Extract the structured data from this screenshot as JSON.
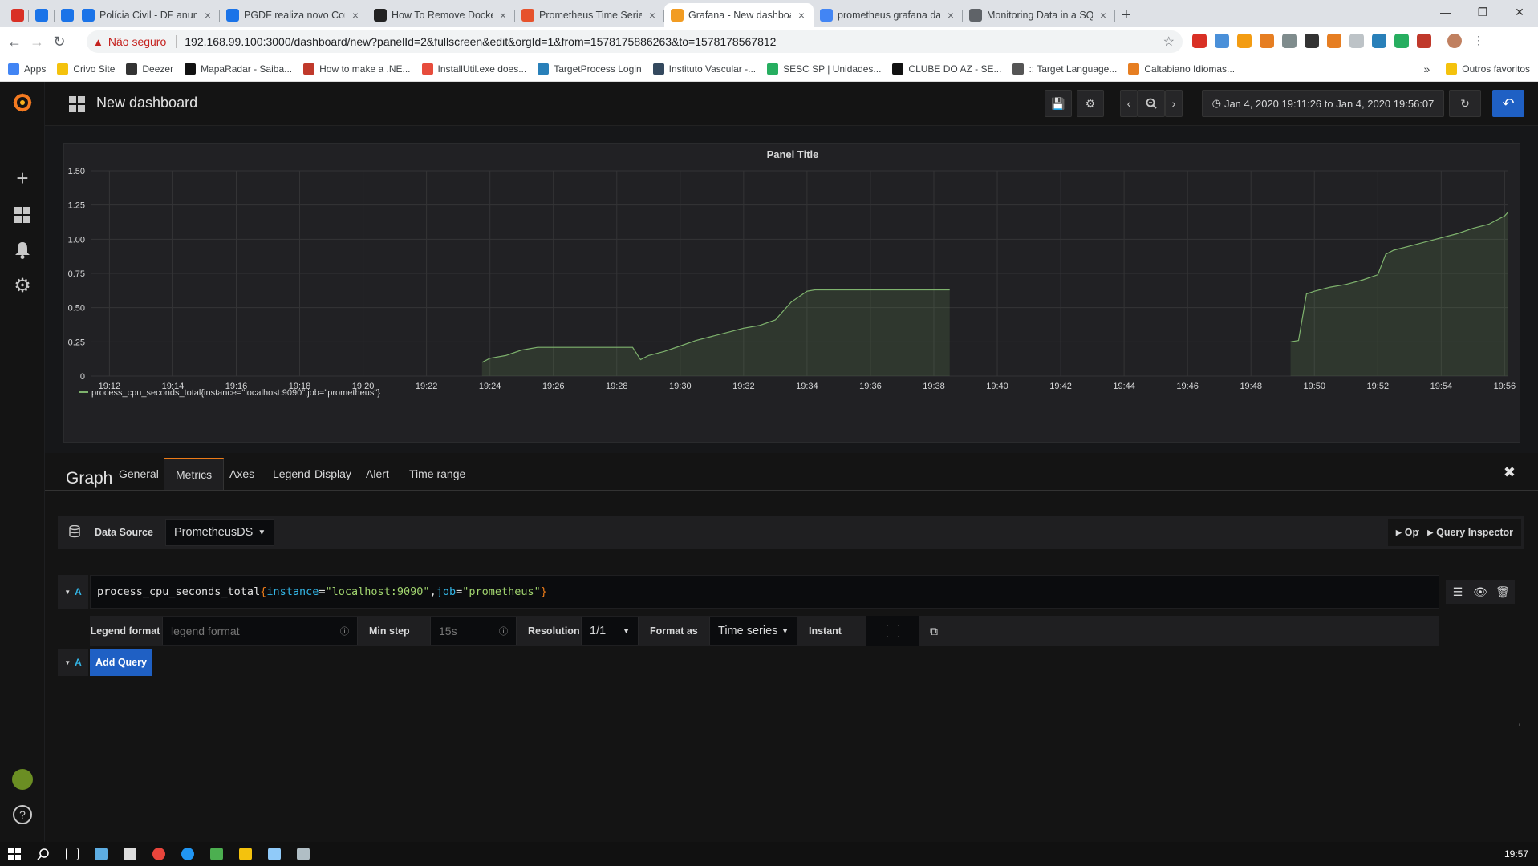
{
  "browser": {
    "tabs": [
      {
        "title": "",
        "icon": "gmail-icon",
        "color": "#d93025"
      },
      {
        "title": "",
        "icon": "pci-icon",
        "color": "#1a73e8"
      },
      {
        "title": "",
        "icon": "chart-icon",
        "color": "#1a73e8"
      },
      {
        "title": "Polícia Civil - DF anuncia Conc",
        "icon": "pci-icon",
        "color": "#1a73e8"
      },
      {
        "title": "PGDF realiza novo Concurso P",
        "icon": "pci-icon",
        "color": "#1a73e8"
      },
      {
        "title": "How To Remove Docker Conta",
        "icon": "hex-icon",
        "color": "#222"
      },
      {
        "title": "Prometheus Time Series Colle",
        "icon": "flame-icon",
        "color": "#e6522c"
      },
      {
        "title": "Grafana - New dashboard",
        "icon": "grafana-icon",
        "color": "#f29c22"
      },
      {
        "title": "prometheus grafana database",
        "icon": "google-icon",
        "color": "#4285f4"
      },
      {
        "title": "Monitoring Data in a SQL Tabl",
        "icon": "globe-icon",
        "color": "#5f6368"
      }
    ],
    "not_secure": "Não seguro",
    "url": "192.168.99.100:3000/dashboard/new?panelId=2&fullscreen&edit&orgId=1&from=1578175886263&to=1578178567812",
    "bookmarks": [
      {
        "label": "Apps",
        "color": "#4285f4"
      },
      {
        "label": "Crivo Site",
        "color": "#f4c20d"
      },
      {
        "label": "Deezer",
        "color": "#333"
      },
      {
        "label": "MapaRadar - Saiba...",
        "color": "#111"
      },
      {
        "label": "How to make a .NE...",
        "color": "#c0392b"
      },
      {
        "label": "InstallUtil.exe does...",
        "color": "#e74c3c"
      },
      {
        "label": "TargetProcess Login",
        "color": "#2980b9"
      },
      {
        "label": "Instituto Vascular -...",
        "color": "#34495e"
      },
      {
        "label": "SESC SP | Unidades...",
        "color": "#27ae60"
      },
      {
        "label": "CLUBE DO AZ - SE...",
        "color": "#111"
      },
      {
        "label": ":: Target Language...",
        "color": "#555"
      },
      {
        "label": "Caltabiano Idiomas...",
        "color": "#e67e22"
      }
    ],
    "more_bookmarks": "»",
    "other_favorites": "Outros favoritos"
  },
  "grafana": {
    "dashboard_title": "New dashboard",
    "time_range": "Jan 4, 2020 19:11:26 to Jan 4, 2020 19:56:07",
    "panel": {
      "title": "Panel Title",
      "legend": "process_cpu_seconds_total{instance=\"localhost:9090\",job=\"prometheus\"}"
    },
    "editor": {
      "panel_type": "Graph",
      "tabs": [
        "General",
        "Metrics",
        "Axes",
        "Legend",
        "Display",
        "Alert",
        "Time range"
      ],
      "active_tab": "Metrics",
      "data_source_label": "Data Source",
      "data_source_value": "PrometheusDS",
      "options_label": "Options",
      "query_inspector_label": "Query Inspector",
      "query_letter": "A",
      "query": {
        "metric": "process_cpu_seconds_total",
        "open_brace": "{",
        "label1_key": "instance",
        "label1_eq": "=",
        "label1_val": "\"localhost:9090\"",
        "comma": ",",
        "label2_key": "job",
        "label2_eq": "=",
        "label2_val": "\"prometheus\"",
        "close_brace": "}"
      },
      "legend_format_label": "Legend format",
      "legend_format_placeholder": "legend format",
      "min_step_label": "Min step",
      "min_step_placeholder": "15s",
      "resolution_label": "Resolution",
      "resolution_value": "1/1",
      "format_as_label": "Format as",
      "format_as_value": "Time series",
      "instant_label": "Instant",
      "add_query_label": "Add Query"
    }
  },
  "taskbar": {
    "clock": "19:57"
  },
  "colors": {
    "series": "#7eb26d",
    "accent": "#eb7b18",
    "primary": "#1f60c4",
    "query_letter": "#33b5e5"
  },
  "chart_data": {
    "type": "area",
    "title": "Panel Title",
    "x_ticks": [
      "19:12",
      "19:14",
      "19:16",
      "19:18",
      "19:20",
      "19:22",
      "19:24",
      "19:26",
      "19:28",
      "19:30",
      "19:32",
      "19:34",
      "19:36",
      "19:38",
      "19:40",
      "19:42",
      "19:44",
      "19:46",
      "19:48",
      "19:50",
      "19:52",
      "19:54",
      "19:56"
    ],
    "y_ticks": [
      "0",
      "0.25",
      "0.50",
      "0.75",
      "1.00",
      "1.25",
      "1.50"
    ],
    "xlim": [
      "19:11:26",
      "19:56:07"
    ],
    "ylim": [
      0,
      1.5
    ],
    "grid": true,
    "legend_position": "bottom",
    "series": [
      {
        "name": "process_cpu_seconds_total{instance=\"localhost:9090\",job=\"prometheus\"}",
        "segments": [
          [
            [
              "19:23:45",
              0.1
            ],
            [
              "19:24:00",
              0.13
            ],
            [
              "19:24:30",
              0.15
            ],
            [
              "19:25:00",
              0.19
            ],
            [
              "19:25:30",
              0.21
            ],
            [
              "19:26:00",
              0.21
            ],
            [
              "19:27:00",
              0.21
            ],
            [
              "19:28:00",
              0.21
            ],
            [
              "19:28:30",
              0.21
            ],
            [
              "19:28:45",
              0.12
            ],
            [
              "19:29:00",
              0.15
            ],
            [
              "19:29:30",
              0.18
            ],
            [
              "19:30:00",
              0.22
            ],
            [
              "19:30:30",
              0.26
            ],
            [
              "19:31:00",
              0.29
            ],
            [
              "19:31:30",
              0.32
            ],
            [
              "19:32:00",
              0.35
            ],
            [
              "19:32:30",
              0.37
            ],
            [
              "19:33:00",
              0.41
            ],
            [
              "19:33:30",
              0.54
            ],
            [
              "19:33:45",
              0.58
            ],
            [
              "19:34:00",
              0.62
            ],
            [
              "19:34:15",
              0.63
            ],
            [
              "19:35:00",
              0.63
            ],
            [
              "19:36:00",
              0.63
            ],
            [
              "19:37:00",
              0.63
            ],
            [
              "19:38:30",
              0.63
            ]
          ],
          [
            [
              "19:49:15",
              0.25
            ],
            [
              "19:49:30",
              0.26
            ],
            [
              "19:49:45",
              0.6
            ],
            [
              "19:50:00",
              0.62
            ],
            [
              "19:50:30",
              0.65
            ],
            [
              "19:51:00",
              0.67
            ],
            [
              "19:51:30",
              0.7
            ],
            [
              "19:52:00",
              0.74
            ],
            [
              "19:52:15",
              0.89
            ],
            [
              "19:52:30",
              0.92
            ],
            [
              "19:53:00",
              0.95
            ],
            [
              "19:53:30",
              0.98
            ],
            [
              "19:54:00",
              1.01
            ],
            [
              "19:54:30",
              1.04
            ],
            [
              "19:55:00",
              1.08
            ],
            [
              "19:55:30",
              1.11
            ],
            [
              "19:56:00",
              1.17
            ],
            [
              "19:56:07",
              1.2
            ]
          ]
        ]
      }
    ]
  }
}
